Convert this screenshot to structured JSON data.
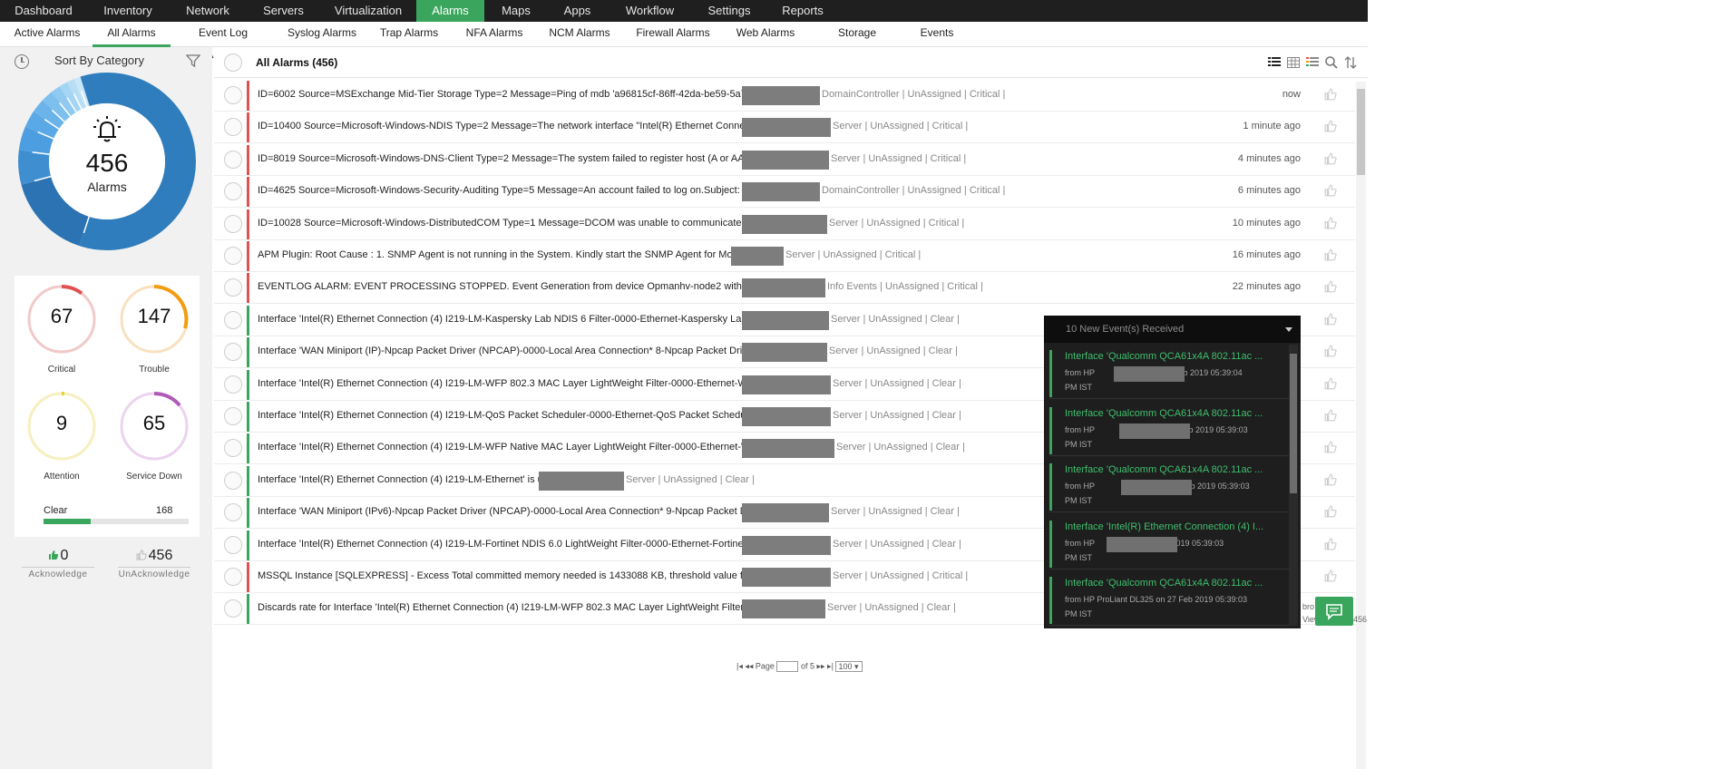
{
  "nav": {
    "items": [
      "Dashboard",
      "Inventory",
      "Network",
      "Servers",
      "Virtualization",
      "Alarms",
      "Maps",
      "Apps",
      "Workflow",
      "Settings",
      "Reports"
    ],
    "active": "Alarms"
  },
  "subnav": {
    "items": [
      "Active Alarms",
      "All Alarms",
      "Event Log Alarms",
      "Syslog Alarms",
      "Trap Alarms",
      "NFA Alarms",
      "NCM Alarms",
      "Firewall Alarms",
      "Web Alarms",
      "Storage Alarms",
      "Events"
    ],
    "active": "All Alarms"
  },
  "left": {
    "sort_label": "Sort By Category",
    "total_count": "456",
    "total_label": "Alarms",
    "severities": [
      {
        "count": "67",
        "label": "Critical",
        "color": "#e05252"
      },
      {
        "count": "147",
        "label": "Trouble",
        "color": "#f39c12"
      },
      {
        "count": "9",
        "label": "Attention",
        "color": "#e8d23a"
      },
      {
        "count": "65",
        "label": "Service Down",
        "color": "#b05ab8"
      }
    ],
    "clear": {
      "label": "Clear",
      "count": "168"
    },
    "acknowledge": {
      "count": "0",
      "label": "Acknowledge"
    },
    "unacknowledge": {
      "count": "456",
      "label": "UnAcknowledge"
    }
  },
  "list": {
    "title": "All Alarms (456)",
    "rows": [
      {
        "msg": "ID=6002 Source=MSExchange Mid-Tier Storage Type=2 Message=Ping of mdb 'a96815cf-86ff-42da-be59-5a7caec...",
        "meta": "DomainController | UnAssigned | Critical |",
        "time": "now",
        "severity": "critical"
      },
      {
        "msg": "ID=10400 Source=Microsoft-Windows-NDIS Type=2 Message=The network interface \"Intel(R) Ethernet Connectio...",
        "meta": "Server | UnAssigned | Critical |",
        "time": "1 minute ago",
        "severity": "critical"
      },
      {
        "msg": "ID=8019 Source=Microsoft-Windows-DNS-Client Type=2 Message=The system failed to register host (A or AAAA) ...",
        "meta": "Server | UnAssigned | Critical |",
        "time": "4 minutes ago",
        "severity": "critical"
      },
      {
        "msg": "ID=4625 Source=Microsoft-Windows-Security-Auditing Type=5 Message=An account failed to log on.Subject: Secu...",
        "meta": "DomainController | UnAssigned | Critical |",
        "time": "6 minutes ago",
        "severity": "critical"
      },
      {
        "msg": "ID=10028 Source=Microsoft-Windows-DistributedCOM Type=1 Message=DCOM was unable to communicate wit...",
        "meta": "Server | UnAssigned | Critical |",
        "time": "10 minutes ago",
        "severity": "critical"
      },
      {
        "msg": "APM Plugin: Root Cause : 1. SNMP Agent is not running in the System. Kindly start the SNMP Agent for Monitoring.",
        "meta": "Server | UnAssigned | Critical |",
        "time": "16 minutes ago",
        "severity": "critical"
      },
      {
        "msg": "EVENTLOG ALARM: EVENT PROCESSING STOPPED. Event Generation from device Opmanhv-node2 with entity O...",
        "meta": "Info Events | UnAssigned | Critical |",
        "time": "22 minutes ago",
        "severity": "critical"
      },
      {
        "msg": "Interface 'Intel(R) Ethernet Connection (4) I219-LM-Kaspersky Lab NDIS 6 Filter-0000-Ethernet-Kaspersky Lab ND...",
        "meta": "Server | UnAssigned | Clear |",
        "time": "",
        "severity": "clear"
      },
      {
        "msg": "Interface 'WAN Miniport (IP)-Npcap Packet Driver (NPCAP)-0000-Local Area Connection* 8-Npcap Packet Driver (...",
        "meta": "Server | UnAssigned | Clear |",
        "time": "",
        "severity": "clear"
      },
      {
        "msg": "Interface 'Intel(R) Ethernet Connection (4) I219-LM-WFP 802.3 MAC Layer LightWeight Filter-0000-Ethernet-WFP...",
        "meta": "Server | UnAssigned | Clear |",
        "time": "",
        "severity": "clear"
      },
      {
        "msg": "Interface 'Intel(R) Ethernet Connection (4) I219-LM-QoS Packet Scheduler-0000-Ethernet-QoS Packet Scheduler-0...",
        "meta": "Server | UnAssigned | Clear |",
        "time": "",
        "severity": "clear"
      },
      {
        "msg": "Interface 'Intel(R) Ethernet Connection (4) I219-LM-WFP Native MAC Layer LightWeight Filter-0000-Ethernet-WF...",
        "meta": "Server | UnAssigned | Clear |",
        "time": "",
        "severity": "clear"
      },
      {
        "msg": "Interface 'Intel(R) Ethernet Connection (4) I219-LM-Ethernet' is up.",
        "meta": "Server | UnAssigned | Clear |",
        "time": "",
        "severity": "clear"
      },
      {
        "msg": "Interface 'WAN Miniport (IPv6)-Npcap Packet Driver (NPCAP)-0000-Local Area Connection* 9-Npcap Packet Drive...",
        "meta": "Server | UnAssigned | Clear |",
        "time": "",
        "severity": "clear"
      },
      {
        "msg": "Interface 'Intel(R) Ethernet Connection (4) I219-LM-Fortinet NDIS 6.0 LightWeight Filter-0000-Ethernet-Fortinet N...",
        "meta": "Server | UnAssigned | Clear |",
        "time": "",
        "severity": "clear"
      },
      {
        "msg": "MSSQL Instance [SQLEXPRESS] - Excess Total committed memory needed is 1433088 KB, threshold value for this m...",
        "meta": "Server | UnAssigned | Critical |",
        "time": "",
        "severity": "critical"
      },
      {
        "msg": "Discards rate for Interface 'Intel(R) Ethernet Connection (4) I219-LM-WFP 802.3 MAC Layer LightWeight Filter-00...",
        "meta": "Server | UnAssigned | Clear |",
        "time": "",
        "severity": "clear"
      }
    ],
    "pager": {
      "page_label": "Page",
      "of_label": "of 5",
      "page_size": "100"
    }
  },
  "events": {
    "header": "10 New Event(s) Received",
    "items": [
      {
        "title": "Interface 'Qualcomm QCA61x4A 802.11ac ...",
        "from": "from HP",
        "date": "on 27 Feb 2019 05:39:04",
        "ist": "PM IST"
      },
      {
        "title": "Interface 'Qualcomm QCA61x4A 802.11ac ...",
        "from": "from HP",
        "date": "on 27 Feb 2019 05:39:03",
        "ist": "PM IST"
      },
      {
        "title": "Interface 'Qualcomm QCA61x4A 802.11ac ...",
        "from": "from HP",
        "date": "on 27 Feb 2019 05:39:03",
        "ist": "PM IST"
      },
      {
        "title": "Interface 'Intel(R) Ethernet Connection (4) I...",
        "from": "from HP",
        "date": "27 Feb 2019 05:39:03",
        "ist": "PM IST"
      },
      {
        "title": "Interface 'Qualcomm QCA61x4A 802.11ac ...",
        "from": "from HP ProLiant DL325 on 27 Feb 2019 05:39:03",
        "date": "",
        "ist": "PM IST"
      }
    ]
  },
  "colors": {
    "accent": "#3aa65d",
    "critical": "#e05252",
    "donut_main": "#2f7dbd"
  }
}
